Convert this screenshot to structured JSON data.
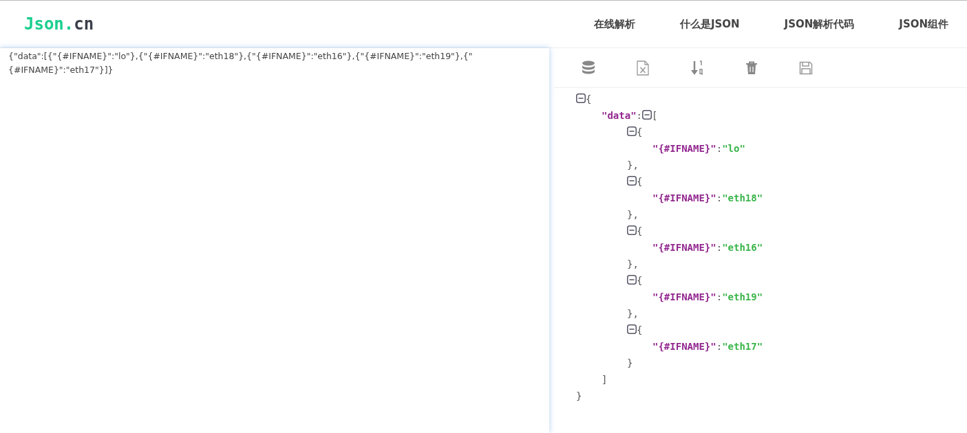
{
  "logo": {
    "main": "Json.",
    "suffix": "cn"
  },
  "nav": [
    "在线解析",
    "什么是JSON",
    "JSON解析代码",
    "JSON组件"
  ],
  "editor": {
    "value": "{\"data\":[{\"{#IFNAME}\":\"lo\"},{\"{#IFNAME}\":\"eth18\"},{\"{#IFNAME}\":\"eth16\"},{\"{#IFNAME}\":\"eth19\"},{\"{#IFNAME}\":\"eth17\"}]}"
  },
  "tree": {
    "open": "{",
    "close": "}",
    "expanded": true,
    "children": [
      {
        "key": "\"data\"",
        "colon": ":",
        "open": "[",
        "close": "]",
        "expanded": true,
        "children": [
          {
            "open": "{",
            "close": "},",
            "expanded": true,
            "children": [
              {
                "key": "\"{#IFNAME}\"",
                "colon": ":",
                "value": "\"lo\""
              }
            ]
          },
          {
            "open": "{",
            "close": "},",
            "expanded": true,
            "children": [
              {
                "key": "\"{#IFNAME}\"",
                "colon": ":",
                "value": "\"eth18\""
              }
            ]
          },
          {
            "open": "{",
            "close": "},",
            "expanded": true,
            "children": [
              {
                "key": "\"{#IFNAME}\"",
                "colon": ":",
                "value": "\"eth16\""
              }
            ]
          },
          {
            "open": "{",
            "close": "},",
            "expanded": true,
            "children": [
              {
                "key": "\"{#IFNAME}\"",
                "colon": ":",
                "value": "\"eth19\""
              }
            ]
          },
          {
            "open": "{",
            "close": "}",
            "expanded": true,
            "children": [
              {
                "key": "\"{#IFNAME}\"",
                "colon": ":",
                "value": "\"eth17\""
              }
            ]
          }
        ]
      }
    ]
  }
}
